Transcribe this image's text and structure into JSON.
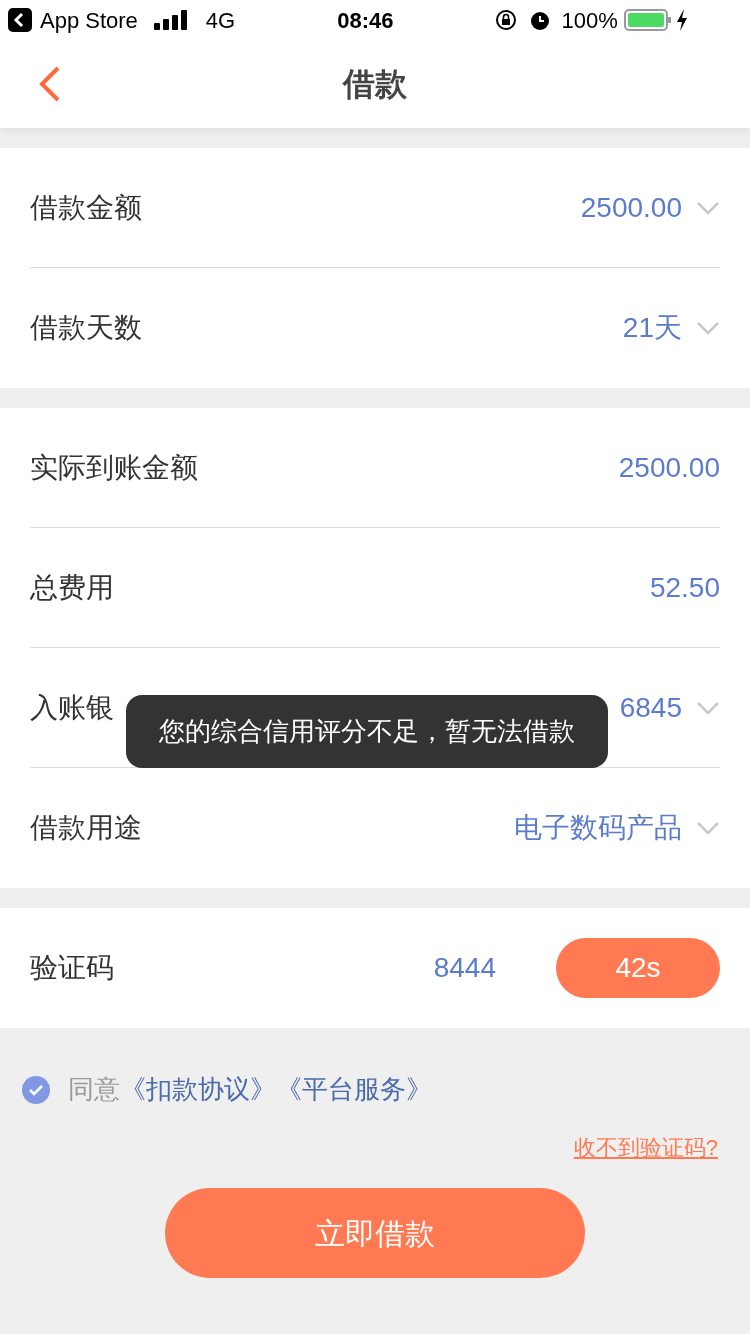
{
  "status_bar": {
    "back_app": "App Store",
    "network": "4G",
    "time": "08:46",
    "battery": "100%"
  },
  "nav": {
    "title": "借款"
  },
  "sections": [
    {
      "rows": [
        {
          "label": "借款金额",
          "value": "2500.00",
          "kind": "select"
        },
        {
          "label": "借款天数",
          "value": "21天",
          "kind": "select"
        }
      ]
    },
    {
      "rows": [
        {
          "label": "实际到账金额",
          "value": "2500.00",
          "kind": "plain"
        },
        {
          "label": "总费用",
          "value": "52.50",
          "kind": "plain"
        },
        {
          "label": "入账银",
          "value": "6845",
          "kind": "select"
        },
        {
          "label": "借款用途",
          "value": "电子数码产品",
          "kind": "select"
        }
      ]
    }
  ],
  "verification": {
    "label": "验证码",
    "value": "8444",
    "countdown": "42s"
  },
  "agreement": {
    "checked": true,
    "prefix": "同意",
    "links": [
      "《扣款协议》",
      "《平台服务》"
    ]
  },
  "help_link": "收不到验证码?",
  "submit": "立即借款",
  "toast": "您的综合信用评分不足，暂无法借款"
}
